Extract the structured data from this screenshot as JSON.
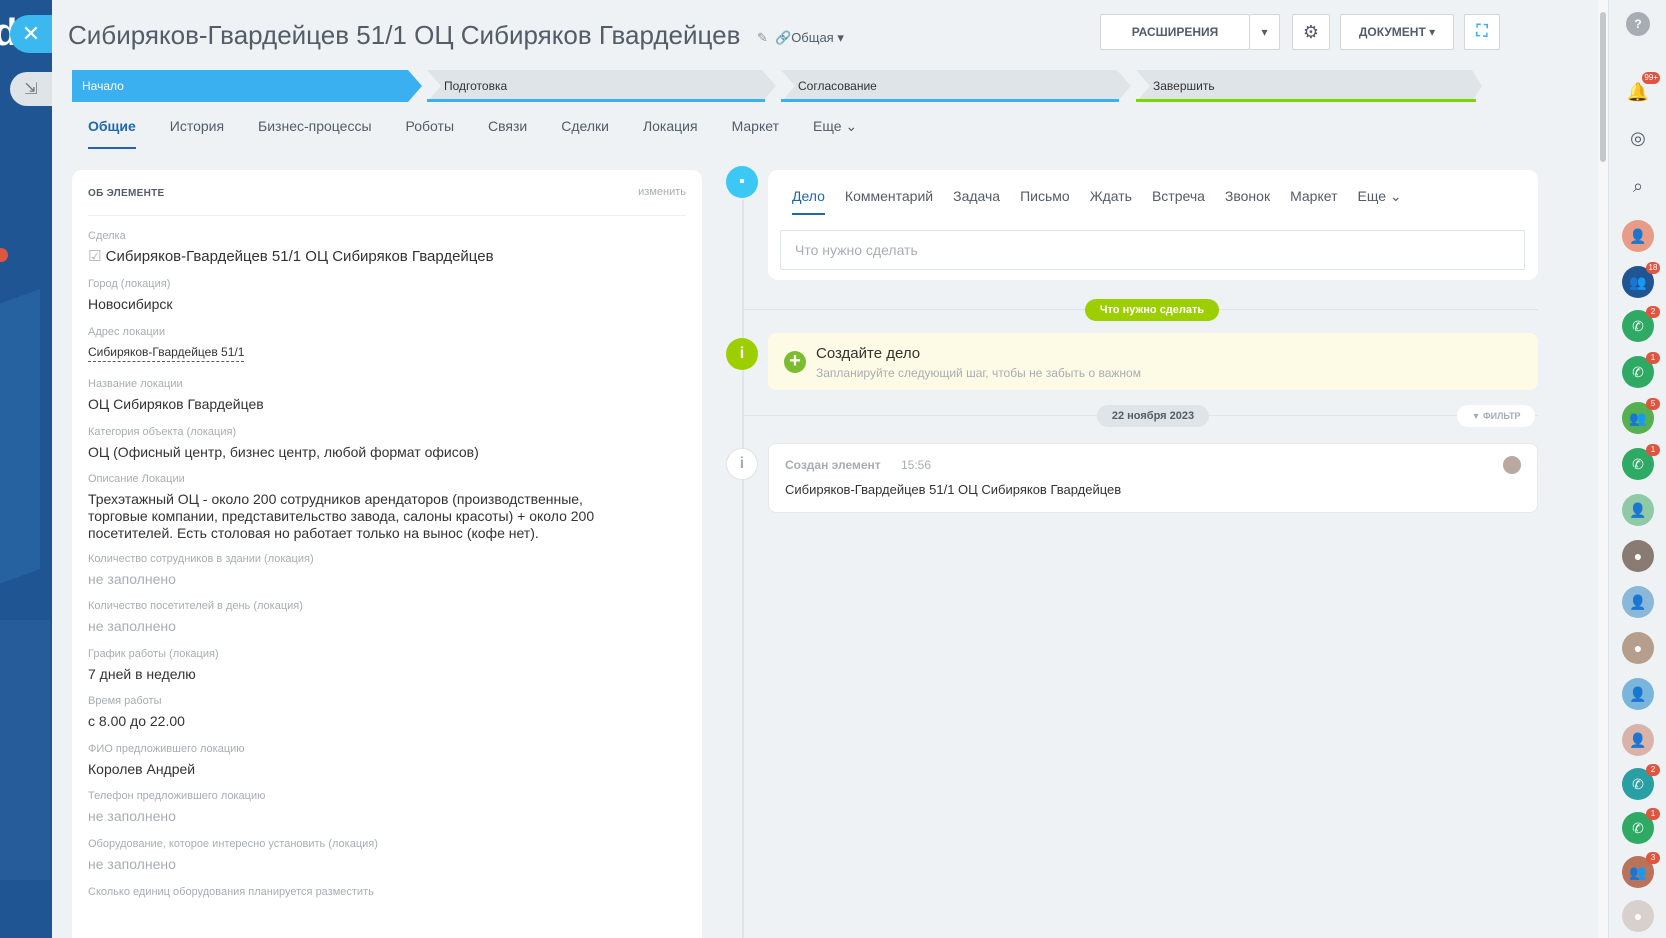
{
  "window": {
    "title": "Сибиряков-Гвардейцев 51/1 ОЦ Сибиряков Гвардейцев",
    "category": "Общая",
    "ext_button": "РАСШИРЕНИЯ",
    "doc_button": "ДОКУМЕНТ"
  },
  "stages": [
    {
      "label": "Начало",
      "color": "#3bb0f0"
    },
    {
      "label": "Подготовка",
      "color": "#3bb0f0"
    },
    {
      "label": "Согласование",
      "color": "#3bb0f0"
    },
    {
      "label": "Завершить",
      "color": "#7bd500"
    }
  ],
  "tabs": [
    "Общие",
    "История",
    "Бизнес-процессы",
    "Роботы",
    "Связи",
    "Сделки",
    "Локация",
    "Маркет",
    "Еще"
  ],
  "card": {
    "header": "ОБ ЭЛЕМЕНТЕ",
    "change": "изменить",
    "fields": [
      {
        "label": "Сделка",
        "value": "Сибиряков-Гвардейцев 51/1 ОЦ Сибиряков Гвардейцев"
      },
      {
        "label": "Город (локация)",
        "value": "Новосибирск"
      },
      {
        "label": "Адрес локации",
        "value": "Сибиряков-Гвардейцев 51/1"
      },
      {
        "label": "Название локации",
        "value": "ОЦ Сибиряков Гвардейцев"
      },
      {
        "label": "Категория объекта (локация)",
        "value": "ОЦ (Офисный центр, бизнес центр, любой формат офисов)"
      },
      {
        "label": "Описание Локации",
        "value": "Трехэтажный ОЦ - около 200 сотрудников арендаторов (производственные, торговые компании, представительство завода, салоны красоты) + около 200 посетителей. Есть столовая но работает только на вынос (кофе нет)."
      },
      {
        "label": "Количество сотрудников в здании (локация)",
        "value": "не заполнено"
      },
      {
        "label": "Количество посетителей в день (локация)",
        "value": "не заполнено"
      },
      {
        "label": "График работы (локация)",
        "value": "7 дней в неделю"
      },
      {
        "label": "Время работы",
        "value": "с 8.00 до 22.00"
      },
      {
        "label": "ФИО предложившего локацию",
        "value": "Королев Андрей"
      },
      {
        "label": "Телефон предложившего локацию",
        "value": "не заполнено"
      },
      {
        "label": "Оборудование, которое интересно установить (локация)",
        "value": "не заполнено"
      },
      {
        "label": "Сколько единиц оборудования планируется разместить",
        "value": ""
      }
    ]
  },
  "editor": {
    "tabs": [
      "Дело",
      "Комментарий",
      "Задача",
      "Письмо",
      "Ждать",
      "Встреча",
      "Звонок",
      "Маркет",
      "Еще"
    ],
    "placeholder": "Что нужно сделать"
  },
  "timeline": {
    "todo_pill": "Что нужно сделать",
    "todo_title": "Создайте дело",
    "todo_sub": "Запланируйте следующий шаг, чтобы не забыть о важном",
    "date": "22 ноября 2023",
    "filter": "ФИЛЬТР",
    "history_title": "Создан элемент",
    "history_time": "15:56",
    "history_text": "Сибиряков-Гвардейцев 51/1 ОЦ Сибиряков Гвардейцев"
  },
  "right_panel": {
    "badges": [
      "99+",
      "18",
      "2",
      "1",
      "5",
      "1",
      "2",
      "1",
      "3"
    ]
  }
}
